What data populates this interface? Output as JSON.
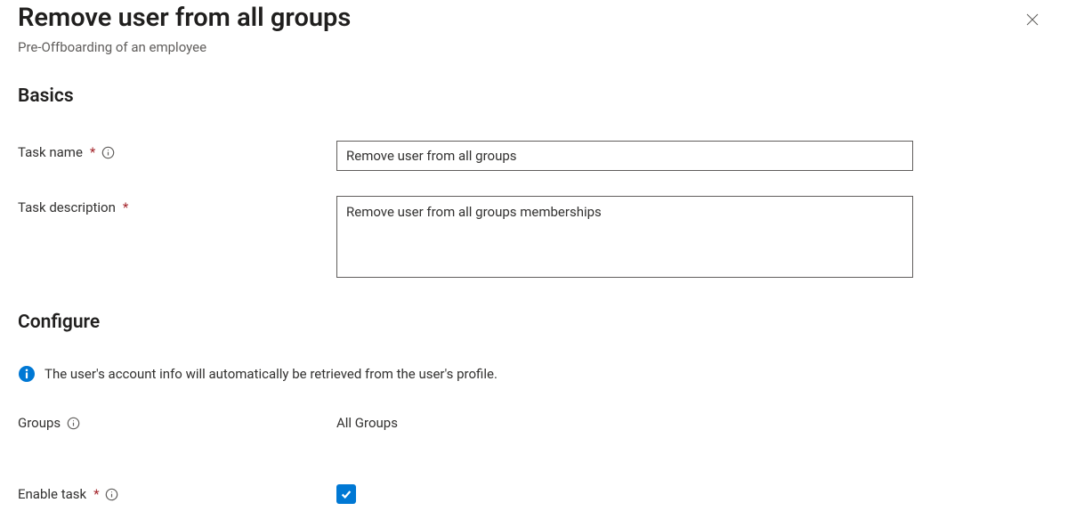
{
  "header": {
    "title": "Remove user from all groups",
    "subtitle": "Pre-Offboarding of an employee"
  },
  "sections": {
    "basics": "Basics",
    "configure": "Configure"
  },
  "fields": {
    "task_name": {
      "label": "Task name",
      "value": "Remove user from all groups"
    },
    "task_description": {
      "label": "Task description",
      "value": "Remove user from all groups memberships"
    },
    "groups": {
      "label": "Groups",
      "value": "All Groups"
    },
    "enable_task": {
      "label": "Enable task",
      "checked": true
    }
  },
  "info_message": "The user's account info will automatically be retrieved from the user's profile."
}
